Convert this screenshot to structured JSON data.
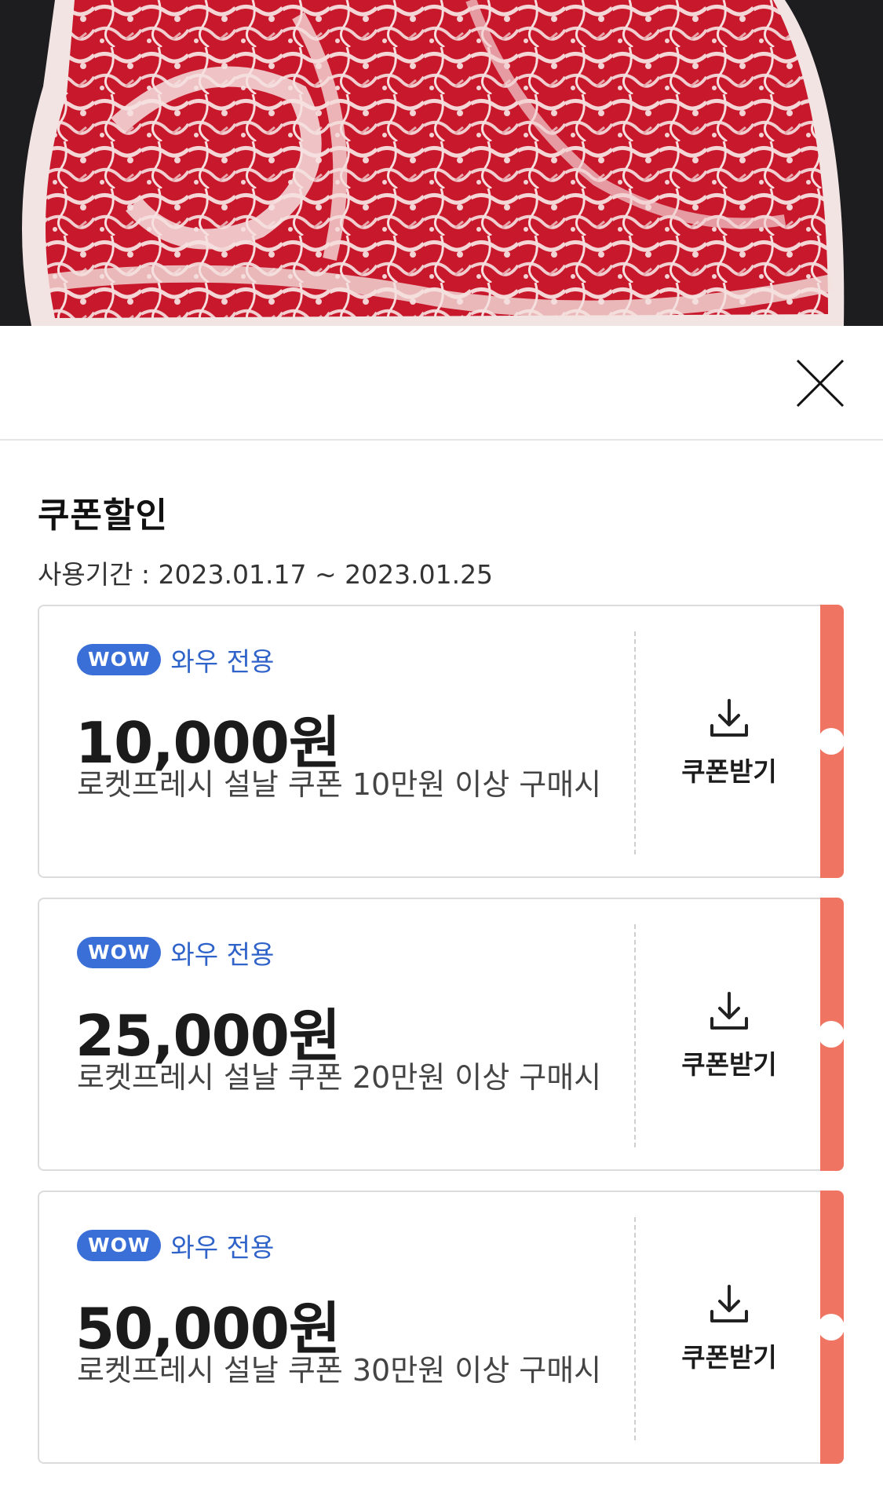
{
  "sheet": {
    "title": "쿠폰할인",
    "period": "사용기간 : 2023.01.17 ~ 2023.01.25"
  },
  "colors": {
    "accent_stripe": "#ef7461",
    "wow_blue": "#3a6fd8",
    "wow_text": "#2f63c9"
  },
  "icons": {
    "close": "close-icon",
    "download": "download-icon"
  },
  "coupons": [
    {
      "badge": "WOW",
      "badge_label": "와우 전용",
      "amount": "10,000원",
      "condition": "로켓프레시 설날 쿠폰 10만원 이상 구매시",
      "action": "쿠폰받기"
    },
    {
      "badge": "WOW",
      "badge_label": "와우 전용",
      "amount": "25,000원",
      "condition": "로켓프레시 설날 쿠폰 20만원 이상 구매시",
      "action": "쿠폰받기"
    },
    {
      "badge": "WOW",
      "badge_label": "와우 전용",
      "amount": "50,000원",
      "condition": "로켓프레시 설날 쿠폰 30만원 이상 구매시",
      "action": "쿠폰받기"
    }
  ]
}
